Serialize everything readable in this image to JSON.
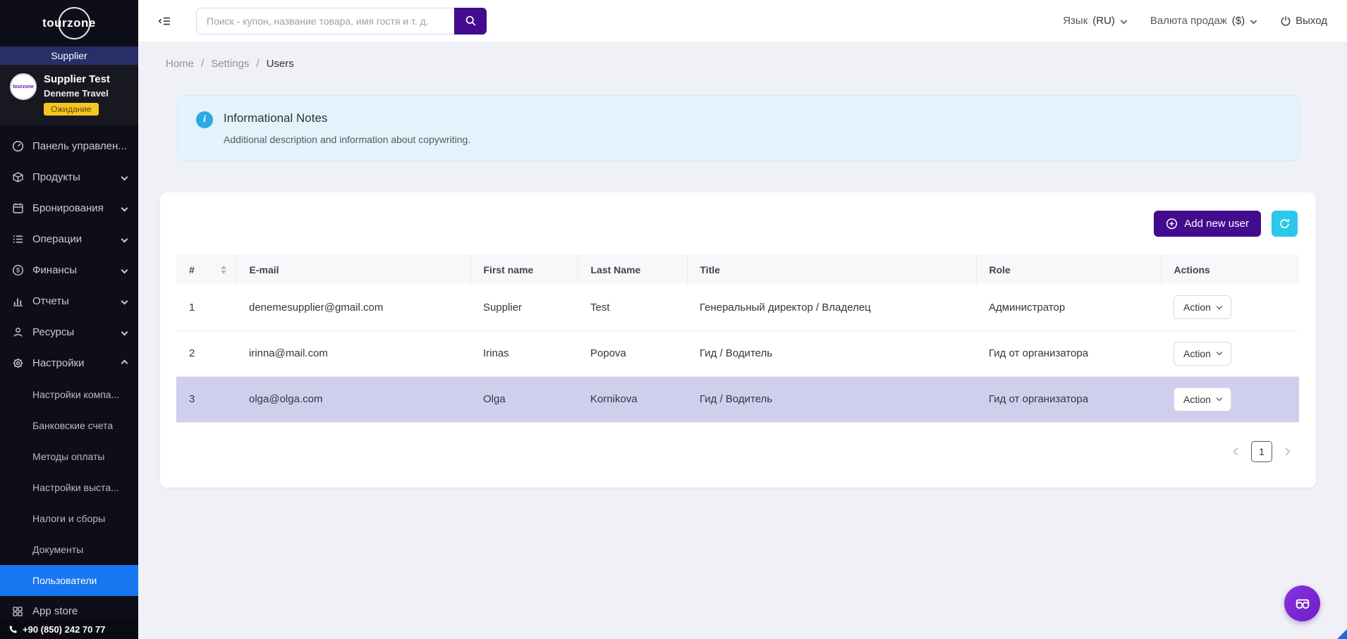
{
  "brand": {
    "logo_text": "tourzone",
    "panel_label": "Supplier"
  },
  "profile": {
    "name": "Supplier Test",
    "company": "Deneme Travel",
    "status_badge": "Ожидание"
  },
  "sidebar": {
    "items": [
      {
        "label": "Панель управлен..."
      },
      {
        "label": "Продукты"
      },
      {
        "label": "Бронирования"
      },
      {
        "label": "Операции"
      },
      {
        "label": "Финансы"
      },
      {
        "label": "Отчеты"
      },
      {
        "label": "Ресурсы"
      },
      {
        "label": "Настройки"
      }
    ],
    "settings_children": [
      "Настройки компа...",
      "Банковские счета",
      "Методы оплаты",
      "Настройки выста...",
      "Налоги и сборы",
      "Документы",
      "Пользователи"
    ],
    "app_store_label": "App store",
    "phone": "+90 (850) 242 70 77"
  },
  "topbar": {
    "search_placeholder": "Поиск - купон, название товара, имя гостя и т. д.",
    "language_label": "Язык",
    "language_value": "(RU)",
    "currency_label": "Валюта продаж",
    "currency_value": "($)",
    "logout_label": "Выход"
  },
  "breadcrumb": {
    "items": [
      "Home",
      "Settings",
      "Users"
    ]
  },
  "info_note": {
    "title": "Informational Notes",
    "description": "Additional description and information about copywriting.",
    "icon_glyph": "i"
  },
  "users": {
    "add_button_label": "Add new user",
    "columns": [
      "#",
      "E-mail",
      "First name",
      "Last Name",
      "Title",
      "Role",
      "Actions"
    ],
    "action_label": "Action",
    "rows": [
      {
        "num": "1",
        "email": "denemesupplier@gmail.com",
        "first": "Supplier",
        "last": "Test",
        "title": "Генеральный директор / Владелец",
        "role": "Администратор"
      },
      {
        "num": "2",
        "email": "irinna@mail.com",
        "first": "Irinas",
        "last": "Popova",
        "title": "Гид / Водитель",
        "role": "Гид от организатора"
      },
      {
        "num": "3",
        "email": "olga@olga.com",
        "first": "Olga",
        "last": "Kornikova",
        "title": "Гид / Водитель",
        "role": "Гид от организатора"
      }
    ],
    "pagination": {
      "current": "1"
    }
  },
  "icons": {
    "names": [
      "menu-fold-icon",
      "search-icon",
      "chevron-down-icon",
      "chevron-up-icon",
      "logout-icon",
      "info-icon",
      "sort-icon",
      "circle-plus-icon",
      "refresh-icon",
      "pagination-prev-icon",
      "pagination-next-icon",
      "support-goggles-icon",
      "phone-icon",
      "dashboard-icon",
      "products-icon",
      "bookings-icon",
      "operations-icon",
      "finance-icon",
      "reports-icon",
      "resources-icon",
      "gear-icon",
      "app-grid-icon"
    ]
  },
  "colors": {
    "sidebar_bg": "#0e0e18",
    "supplier_bar": "#272e68",
    "active_item": "#1677f0",
    "primary_purple": "#430b8e",
    "refresh_cyan": "#2bc8ea",
    "info_bg": "#e4f2fb",
    "info_icon": "#2ea9e5",
    "badge_yellow": "#f3c623",
    "row_highlight": "#cfcfed",
    "page_bg": "#f0f1f6"
  }
}
